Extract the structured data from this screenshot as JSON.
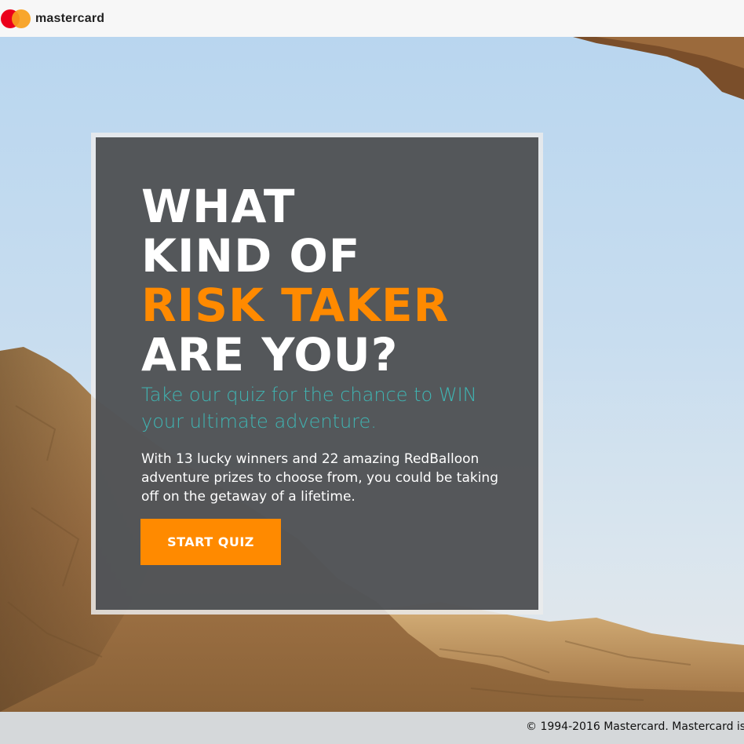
{
  "brand": {
    "name": "mastercard",
    "logo_icon": "mastercard-logo-icon",
    "colors": {
      "red": "#eb001b",
      "orange": "#f79e1b"
    }
  },
  "hero": {
    "headline": {
      "line1": "WHAT",
      "line2": "KIND OF",
      "line3": "RISK TAKER",
      "line4": "ARE YOU?"
    },
    "subhead": "Take our quiz for the chance to WIN your ultimate adventure.",
    "body": "With 13 lucky winners and 22 amazing RedBalloon adventure prizes to choose from, you could be taking off on the getaway of a lifetime.",
    "cta_label": "START QUIZ",
    "colors": {
      "accent": "#ff8a00",
      "subhead": "#3fb5b3",
      "card": "#404246"
    }
  },
  "footer": {
    "copyright": "© 1994-2016 Mastercard. Mastercard is"
  }
}
